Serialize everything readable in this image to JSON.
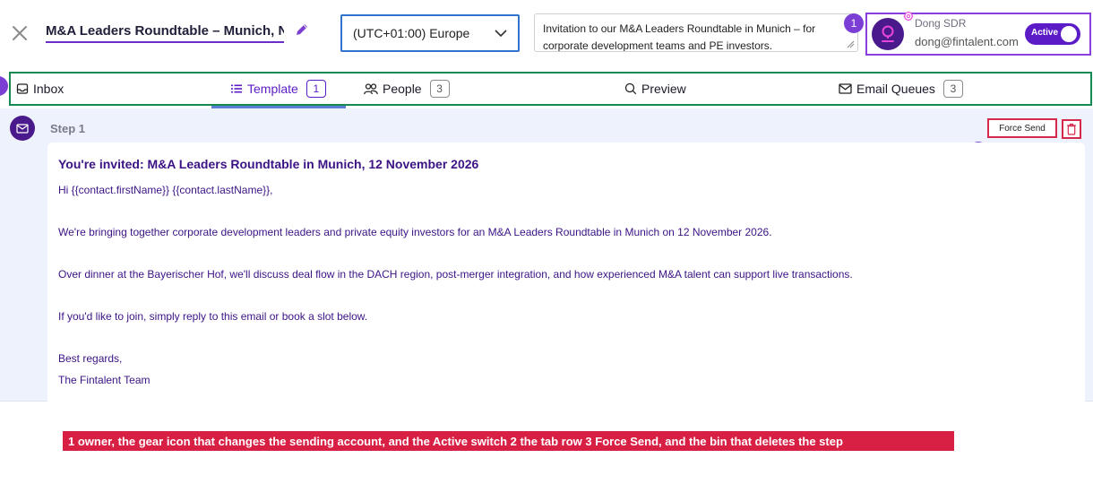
{
  "header": {
    "title_value": "M&A Leaders Roundtable – Munich, November",
    "timezone": "(UTC+01:00) Europe",
    "description": "Invitation to our M&A Leaders Roundtable in Munich – for corporate development teams and PE investors.",
    "owner": {
      "name": "Dong SDR",
      "email": "dong@fintalent.com",
      "toggle_label": "Active"
    }
  },
  "markers": [
    "1",
    "",
    "3"
  ],
  "tabs": [
    {
      "label": "Inbox",
      "icon": "inbox-icon"
    },
    {
      "label": "Template",
      "icon": "list-icon",
      "count": "1"
    },
    {
      "label": "People",
      "icon": "people-icon",
      "count": "3"
    },
    {
      "label": "Preview",
      "icon": "search-icon"
    },
    {
      "label": "Email Queues",
      "icon": "mail-icon",
      "count": "3"
    }
  ],
  "step": {
    "label": "Step 1",
    "force_send_label": "Force Send",
    "email": {
      "subject": "You're invited: M&A Leaders Roundtable in Munich, 12 November 2026",
      "lines": [
        "Hi {{contact.firstName}} {{contact.lastName}},",
        "",
        "We're bringing together corporate development leaders and private equity investors for an M&A Leaders Roundtable in Munich on 12 November 2026.",
        "",
        "Over dinner at the Bayerischer Hof, we'll discuss deal flow in the DACH region, post-merger integration, and how experienced M&A talent can support live transactions.",
        "",
        "If you'd like to join, simply reply to this email or book a slot below.",
        "",
        "Best regards,",
        "The Fintalent Team"
      ]
    }
  },
  "legend": "1 owner, the gear icon that changes the sending account, and the Active switch   2 the tab row   3 Force Send, and the bin that deletes the step",
  "colors": {
    "accent_purple": "#5b1cc7",
    "annotation_red": "#d81f44",
    "tab_row_border": "#158a52",
    "owner_border": "#8a3fdc",
    "timezone_border": "#2e74cf",
    "step_panel_bg": "#eef2fc"
  }
}
